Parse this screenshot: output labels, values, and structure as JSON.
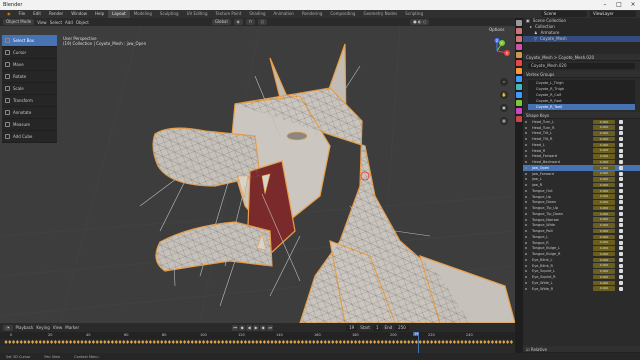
{
  "window": {
    "title": "Blender"
  },
  "menu": {
    "items": [
      "File",
      "Edit",
      "Render",
      "Window",
      "Help"
    ],
    "workspaces": [
      "Layout",
      "Modeling",
      "Sculpting",
      "UV Editing",
      "Texture Paint",
      "Shading",
      "Animation",
      "Rendering",
      "Compositing",
      "Geometry Nodes",
      "Scripting"
    ],
    "active_workspace": "Layout",
    "scene": "Scene",
    "view_layer": "ViewLayer"
  },
  "viewport_header": {
    "mode": "Object Mode",
    "menus": [
      "View",
      "Select",
      "Add",
      "Object"
    ],
    "orientation": "Global",
    "options": "Options"
  },
  "viewport": {
    "perspective": "User Perspective",
    "object_info": "(19) Collection | Coyote_Mesh : jaw_Open"
  },
  "tools": [
    {
      "label": "Select Box",
      "icon": "select-box-icon",
      "active": true
    },
    {
      "label": "Cursor",
      "icon": "cursor-icon",
      "active": false
    },
    {
      "label": "Move",
      "icon": "move-icon",
      "active": false
    },
    {
      "label": "Rotate",
      "icon": "rotate-icon",
      "active": false
    },
    {
      "label": "Scale",
      "icon": "scale-icon",
      "active": false
    },
    {
      "label": "Transform",
      "icon": "transform-icon",
      "active": false
    },
    {
      "label": "Annotate",
      "icon": "annotate-icon",
      "active": false
    },
    {
      "label": "Measure",
      "icon": "measure-icon",
      "active": false
    },
    {
      "label": "Add Cube",
      "icon": "add-cube-icon",
      "active": false
    }
  ],
  "gizmo": {
    "x": "X",
    "y": "Y",
    "z": "Z"
  },
  "timeline": {
    "menus": [
      "Playback",
      "Keying",
      "View",
      "Marker"
    ],
    "current_frame": "19",
    "start_label": "Start",
    "start": "1",
    "end_label": "End",
    "end": "250",
    "ruler": [
      "0",
      "20",
      "40",
      "60",
      "80",
      "100",
      "120",
      "140",
      "160",
      "180",
      "200",
      "220",
      "240"
    ]
  },
  "status": {
    "items": [
      "Set 3D Cursor",
      "Pan View",
      "Context Menu"
    ]
  },
  "outliner": {
    "title": "Scene Collection",
    "rows": [
      "Collection",
      "Armature",
      "Coyote_Mesh"
    ]
  },
  "properties": {
    "breadcrumb": "Coyote_Mesh > Coyote_Mesh.020",
    "mesh_name": "Coyote_Mesh.020",
    "vertex_groups_title": "Vertex Groups",
    "vertex_groups": [
      "Coyote_L_Thigh",
      "Coyote_R_Thigh",
      "Coyote_R_Calf",
      "Coyote_R_Foot",
      "Coyote_R_Toe0"
    ],
    "vertex_group_selected": 4,
    "shape_keys_title": "Shape Keys",
    "shape_keys": [
      {
        "name": "Head_Turn_L",
        "value": "0.000"
      },
      {
        "name": "Head_Turn_R",
        "value": "0.000"
      },
      {
        "name": "Head_Tilt_L",
        "value": "0.000"
      },
      {
        "name": "Head_Tilt_R",
        "value": "0.000"
      },
      {
        "name": "Head_L",
        "value": "0.000"
      },
      {
        "name": "Head_R",
        "value": "0.000"
      },
      {
        "name": "Head_Forward",
        "value": "0.000"
      },
      {
        "name": "Head_Backward",
        "value": "0.000"
      },
      {
        "name": "jaw_Open",
        "value": "1.000"
      },
      {
        "name": "jaw_Forward",
        "value": "0.000"
      },
      {
        "name": "jaw_L",
        "value": "0.000"
      },
      {
        "name": "jaw_R",
        "value": "0.000"
      },
      {
        "name": "Tongue_Out",
        "value": "0.000"
      },
      {
        "name": "Tongue_Up",
        "value": "0.000"
      },
      {
        "name": "Tongue_Down",
        "value": "0.000"
      },
      {
        "name": "Tongue_Tip_Up",
        "value": "0.000"
      },
      {
        "name": "Tongue_Tip_Down",
        "value": "0.000"
      },
      {
        "name": "Tongue_Narrow",
        "value": "0.000"
      },
      {
        "name": "Tongue_Wide",
        "value": "0.000"
      },
      {
        "name": "Tongue_Roll",
        "value": "0.000"
      },
      {
        "name": "Tongue_L",
        "value": "0.000"
      },
      {
        "name": "Tongue_R",
        "value": "0.000"
      },
      {
        "name": "Tongue_Bulge_L",
        "value": "0.000"
      },
      {
        "name": "Tongue_Bulge_R",
        "value": "0.000"
      },
      {
        "name": "Eye_Blink_L",
        "value": "0.000"
      },
      {
        "name": "Eye_Blink_R",
        "value": "0.000"
      },
      {
        "name": "Eye_Squint_L",
        "value": "0.000"
      },
      {
        "name": "Eye_Squint_R",
        "value": "0.000"
      },
      {
        "name": "Eye_Wide_L",
        "value": "0.000"
      },
      {
        "name": "Eye_Wide_R",
        "value": "0.000"
      }
    ],
    "shape_key_selected": 8,
    "relative_label": "Relative"
  },
  "colors": {
    "accent": "#4772b3",
    "mesh_outline": "#e8a04a",
    "mesh_fill": "#c9c4bd",
    "viewport_bg": "#3d3d3d"
  }
}
